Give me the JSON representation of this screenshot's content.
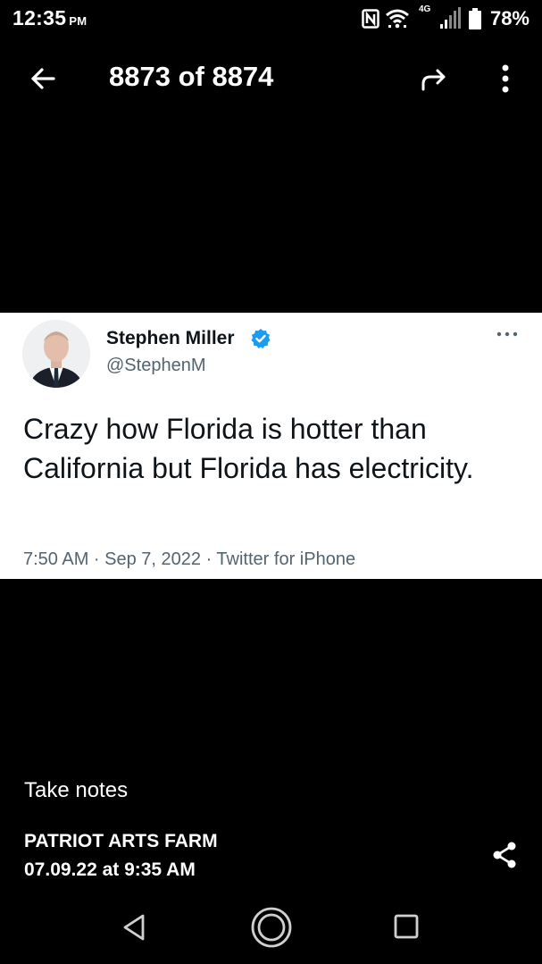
{
  "status_bar": {
    "time": "12:35",
    "ampm": "PM",
    "network": "4G",
    "battery": "78%",
    "icons": [
      "nfc-icon",
      "wifi-icon",
      "signal-icon",
      "battery-icon"
    ]
  },
  "top_bar": {
    "counter": "8873 of 8874",
    "icons": [
      "back-arrow-icon",
      "forward-arrow-icon",
      "more-vertical-icon"
    ]
  },
  "tweet": {
    "author_name": "Stephen Miller",
    "author_handle": "@StephenM",
    "text": "Crazy how Florida is hotter than California but Florida has electricity.",
    "meta": "7:50 AM · Sep 7, 2022 · Twitter for iPhone",
    "verified_color": "#1d9bf0"
  },
  "message": {
    "caption": "Take notes",
    "sender": "PATRIOT ARTS FARM",
    "timestamp": "07.09.22 at 9:35 AM"
  },
  "nav_bar": {
    "icons": [
      "nav-back-icon",
      "nav-home-icon",
      "nav-recents-icon"
    ]
  }
}
